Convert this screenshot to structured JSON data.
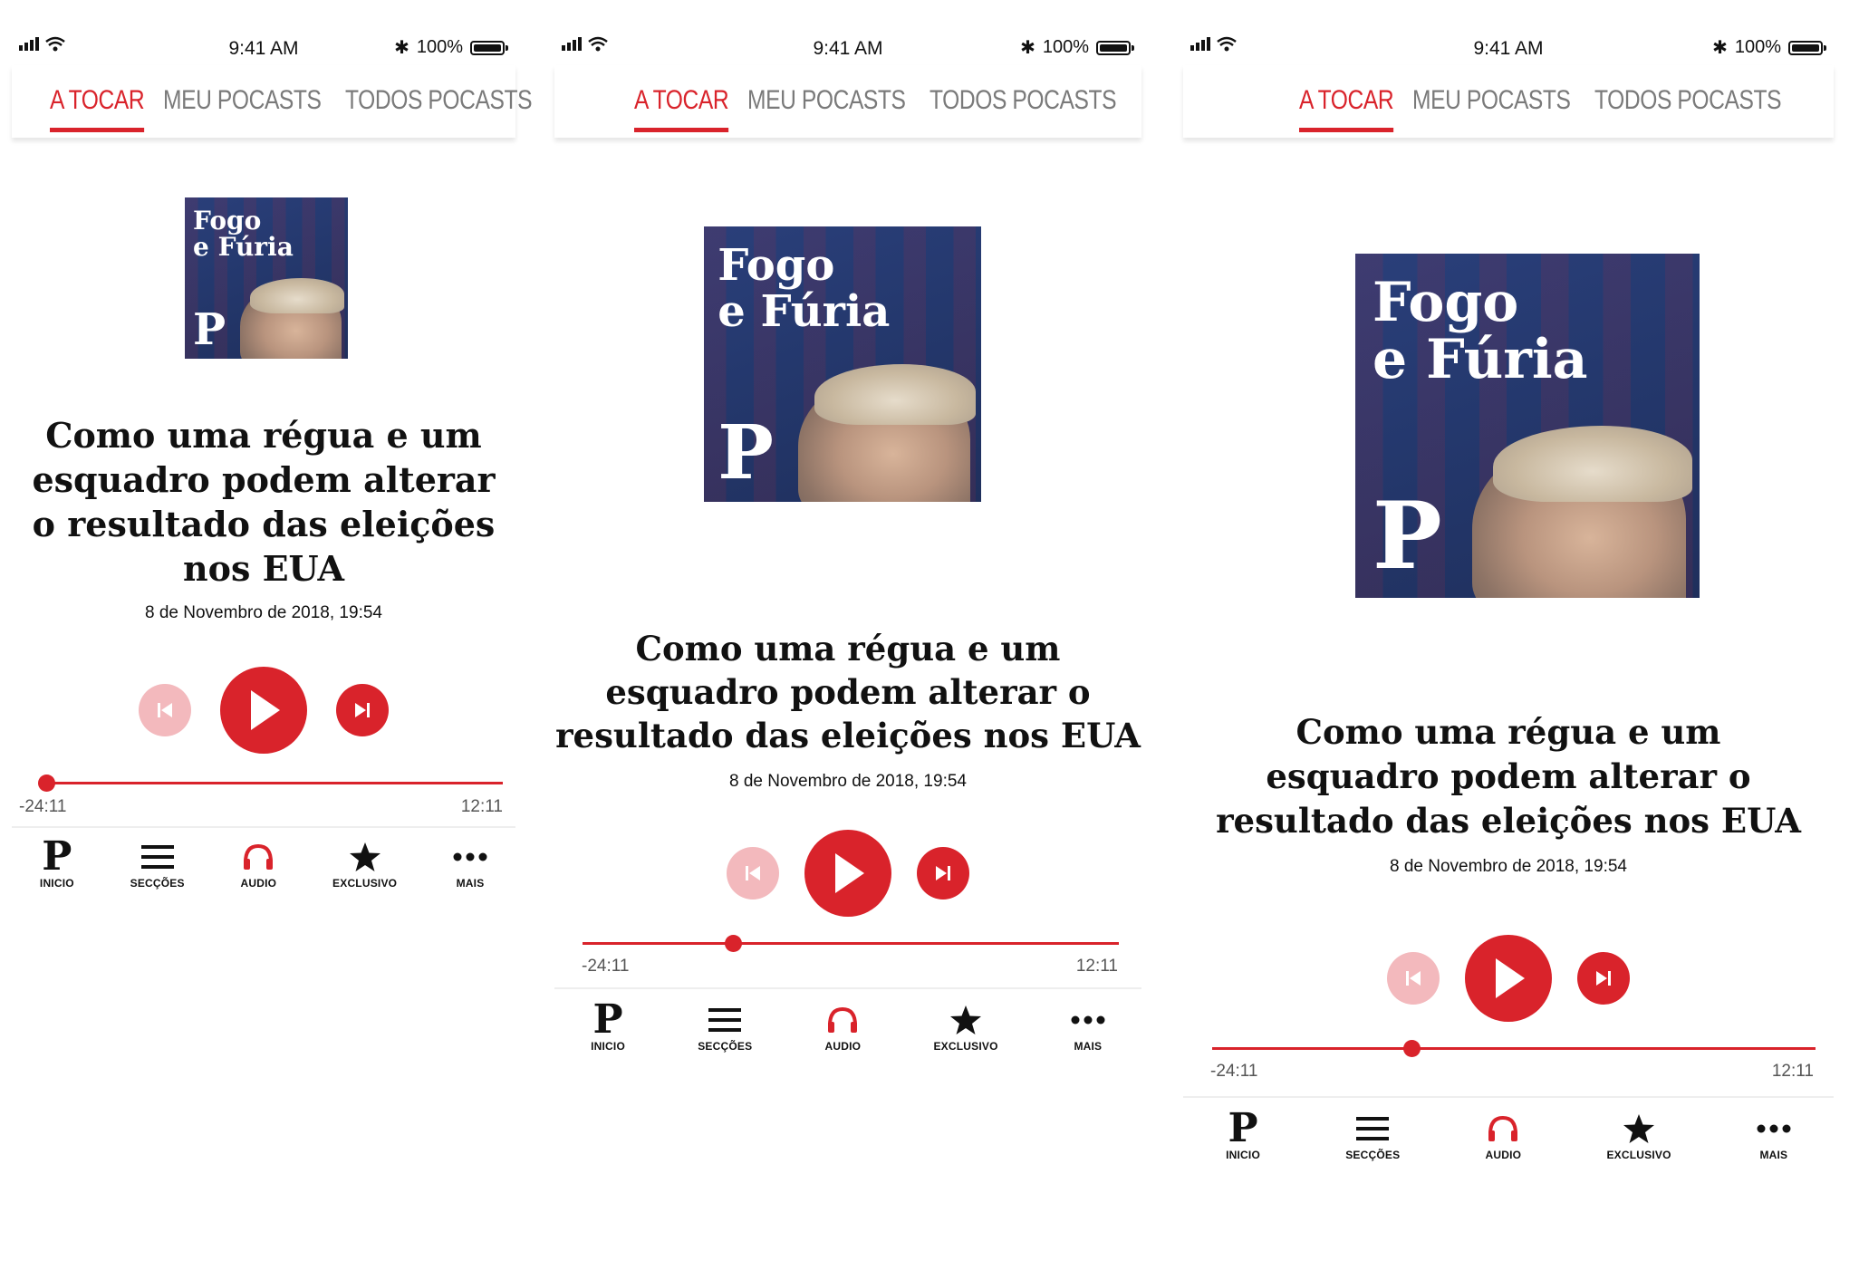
{
  "status_bar": {
    "time": "9:41 AM",
    "battery": "100%"
  },
  "tabs": [
    "A TOCAR",
    "MEU POCASTS",
    "TODOS POCASTS"
  ],
  "cover": {
    "title_line1": "Fogo",
    "title_line2": "e Fúria",
    "logo": "P"
  },
  "episode": {
    "title_p1": [
      "Como uma régua e um",
      "esquadro podem alterar",
      "o resultado das eleições",
      "nos EUA"
    ],
    "title_p2": [
      "Como uma régua e um",
      "esquadro podem alterar o",
      "resultado das eleições nos EUA"
    ],
    "date": "8 de Novembro de 2018, 19:54"
  },
  "progress": {
    "elapsed": "-24:11",
    "total": "12:11",
    "position_fraction": [
      0.0,
      0.28,
      0.33
    ]
  },
  "nav": {
    "inicio": "INICIO",
    "seccoes": "SECÇÕES",
    "audio": "AUDIO",
    "exclusivo": "EXCLUSIVO",
    "mais": "MAIS",
    "logo": "P"
  },
  "colors": {
    "accent": "#d9232b",
    "accent_light": "#f3b9bd",
    "cover_bg": "#24386d"
  },
  "icons": [
    "signal-icon",
    "wifi-icon",
    "bluetooth-icon",
    "battery-icon",
    "previous-icon",
    "play-icon",
    "next-icon",
    "menu-icon",
    "headphones-icon",
    "star-icon",
    "more-icon"
  ]
}
